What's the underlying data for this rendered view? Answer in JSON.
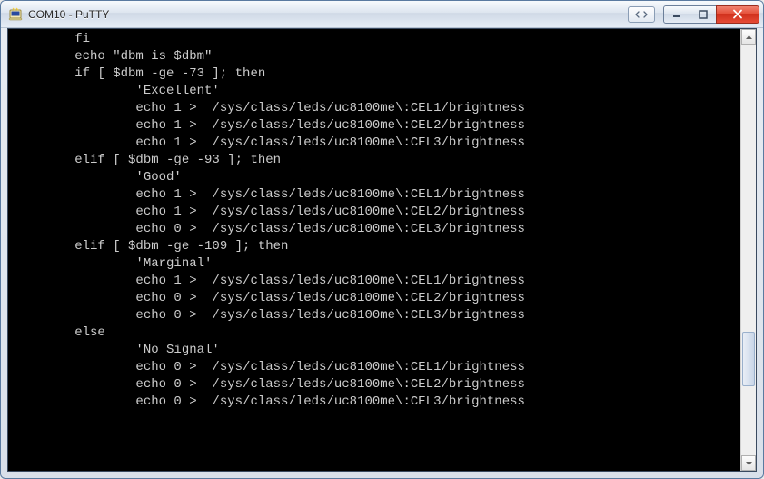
{
  "window": {
    "title": "COM10 - PuTTY",
    "icons": {
      "app": "putty-icon",
      "extra": "double-arrow-icon",
      "minimize": "minimize-icon",
      "maximize": "maximize-icon",
      "close": "close-icon"
    }
  },
  "terminal": {
    "lines": [
      "        fi",
      "",
      "        echo \"dbm is $dbm\"",
      "",
      "        if [ $dbm -ge -73 ]; then",
      "                'Excellent'",
      "                echo 1 >  /sys/class/leds/uc8100me\\:CEL1/brightness",
      "                echo 1 >  /sys/class/leds/uc8100me\\:CEL2/brightness",
      "                echo 1 >  /sys/class/leds/uc8100me\\:CEL3/brightness",
      "        elif [ $dbm -ge -93 ]; then",
      "                'Good'",
      "                echo 1 >  /sys/class/leds/uc8100me\\:CEL1/brightness",
      "                echo 1 >  /sys/class/leds/uc8100me\\:CEL2/brightness",
      "                echo 0 >  /sys/class/leds/uc8100me\\:CEL3/brightness",
      "        elif [ $dbm -ge -109 ]; then",
      "                'Marginal'",
      "                echo 1 >  /sys/class/leds/uc8100me\\:CEL1/brightness",
      "                echo 0 >  /sys/class/leds/uc8100me\\:CEL2/brightness",
      "                echo 0 >  /sys/class/leds/uc8100me\\:CEL3/brightness",
      "        else",
      "                'No Signal'",
      "                echo 0 >  /sys/class/leds/uc8100me\\:CEL1/brightness",
      "                echo 0 >  /sys/class/leds/uc8100me\\:CEL2/brightness",
      "                echo 0 >  /sys/class/leds/uc8100me\\:CEL3/brightness"
    ]
  }
}
